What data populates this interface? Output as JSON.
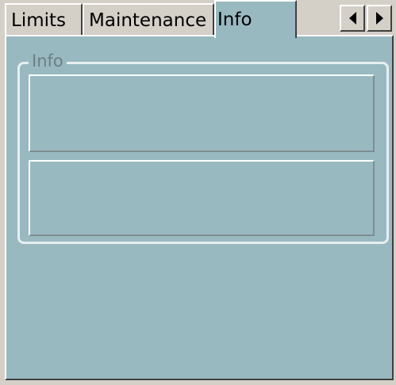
{
  "tabs": [
    {
      "label": "Limits",
      "active": false
    },
    {
      "label": "Maintenance",
      "active": false
    },
    {
      "label": "Info",
      "active": true
    }
  ],
  "tab_scroll": {
    "left_icon": "arrow-left-icon",
    "right_icon": "arrow-right-icon"
  },
  "info_group": {
    "label": "Info",
    "fields": [
      "",
      ""
    ]
  },
  "colors": {
    "panel_background": "#99b9c1",
    "window_background": "#d4d0c8"
  }
}
